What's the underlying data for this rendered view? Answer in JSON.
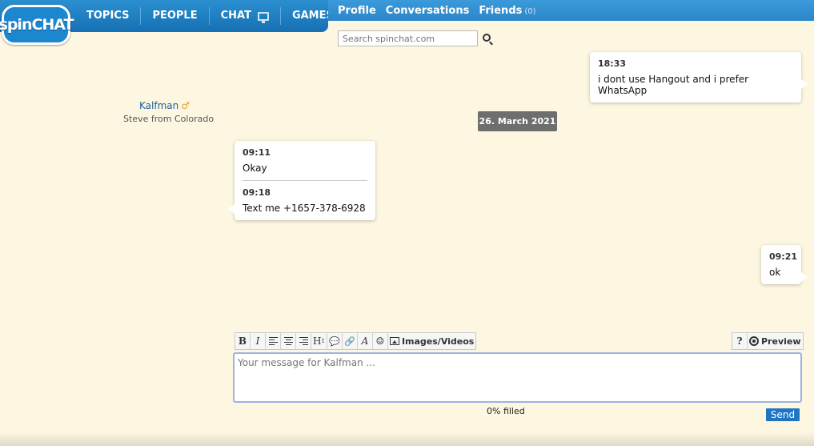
{
  "logo": {
    "text": "spinCHAT"
  },
  "nav": {
    "topics": "TOPICS",
    "people": "PEOPLE",
    "chat": "CHAT",
    "games": "GAMES"
  },
  "subnav": {
    "profile": "Profile",
    "conversations": "Conversations",
    "friends": "Friends",
    "friends_count": "(0)"
  },
  "search": {
    "placeholder": "Search spinchat.com"
  },
  "contact": {
    "name": "Kalfman",
    "gender_icon": "male-icon",
    "subtitle": "Steve from Colorado"
  },
  "messages": [
    {
      "time": "18:33",
      "text": "i dont use Hangout and i prefer WhatsApp",
      "side": "right"
    },
    {
      "time": "09:11",
      "text": "Okay",
      "side": "left"
    },
    {
      "time": "09:18",
      "text": "Text me +1657-378-6928",
      "side": "left"
    },
    {
      "time": "09:21",
      "text": "ok",
      "side": "right"
    }
  ],
  "date_separator": "26. March 2021",
  "toolbar": {
    "bold": "B",
    "italic": "I",
    "heading": "H",
    "font": "A",
    "images_videos": "Images/Videos",
    "help": "?",
    "preview": "Preview"
  },
  "composer": {
    "placeholder": "Your message for Kalfman ...",
    "fill_status": "0% filled",
    "send": "Send"
  }
}
